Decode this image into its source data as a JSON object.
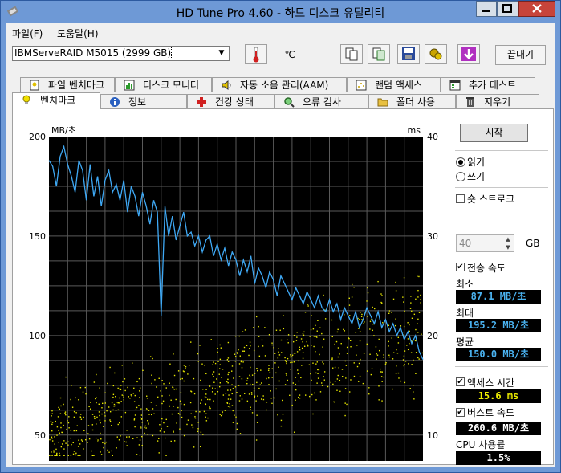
{
  "window": {
    "title": "HD Tune Pro 4.60 - 하드 디스크 유틸리티"
  },
  "menu": {
    "file": "파일(F)",
    "help": "도움말(H)"
  },
  "toolbar": {
    "drive": "IBMServeRAID M5015 (2999 GB)",
    "temperature": "-- ℃",
    "exit": "끝내기",
    "icons": [
      "copy-icon",
      "copy-info-icon",
      "save-icon",
      "options-icon",
      "download-icon"
    ]
  },
  "tabs_top": [
    {
      "label": "파일 벤치마크",
      "icon": "file-benchmark-icon"
    },
    {
      "label": "디스크 모니터",
      "icon": "disk-monitor-icon"
    },
    {
      "label": "자동 소음 관리(AAM)",
      "icon": "speaker-icon"
    },
    {
      "label": "랜덤 액세스",
      "icon": "random-access-icon"
    },
    {
      "label": "추가 테스트",
      "icon": "extra-tests-icon"
    }
  ],
  "tabs_bottom": [
    {
      "label": "벤치마크",
      "icon": "lightbulb-icon",
      "active": true
    },
    {
      "label": "정보",
      "icon": "info-icon"
    },
    {
      "label": "건강 상태",
      "icon": "health-cross-icon"
    },
    {
      "label": "오류 검사",
      "icon": "magnifier-icon"
    },
    {
      "label": "폴더 사용",
      "icon": "folder-icon"
    },
    {
      "label": "지우기",
      "icon": "trash-icon"
    }
  ],
  "controls": {
    "start": "시작",
    "read": "읽기",
    "write": "쓰기",
    "short_stroke": "숏 스트로크",
    "short_stroke_value": "40",
    "gb": "GB",
    "transfer_rate": "전송 속도",
    "min_label": "최소",
    "min_value": "87.1 MB/초",
    "max_label": "최대",
    "max_value": "195.2 MB/초",
    "avg_label": "평균",
    "avg_value": "150.0 MB/초",
    "access_time": "엑세스 시간",
    "access_value": "15.6 ms",
    "burst_rate": "버스트 속도",
    "burst_value": "260.6 MB/초",
    "cpu_label": "CPU 사용률",
    "cpu_value": "1.5%"
  },
  "colors": {
    "transfer_line": "#3fa9f5",
    "access_dots": "#e8e800",
    "plot_bg": "#000000"
  },
  "chart_data": {
    "type": "line",
    "ylabel_left": "MB/초",
    "ylabel_right": "ms",
    "yticks_left": [
      50,
      100,
      150,
      200
    ],
    "yticks_right": [
      10,
      20,
      30,
      40
    ],
    "ylim_left": [
      37,
      200
    ],
    "ylim_right": [
      7.4,
      40
    ],
    "x": [
      0,
      1,
      2,
      3,
      4,
      5,
      6,
      7,
      8,
      9,
      10,
      11,
      12,
      13,
      14,
      15,
      16,
      17,
      18,
      19,
      20,
      21,
      22,
      23,
      24,
      25,
      26,
      27,
      28,
      29,
      30,
      31,
      32,
      33,
      34,
      35,
      36,
      37,
      38,
      39,
      40,
      41,
      42,
      43,
      44,
      45,
      46,
      47,
      48,
      49,
      50,
      51,
      52,
      53,
      54,
      55,
      56,
      57,
      58,
      59,
      60,
      61,
      62,
      63,
      64,
      65,
      66,
      67,
      68,
      69,
      70,
      71,
      72,
      73,
      74,
      75,
      76,
      77,
      78,
      79,
      80,
      81,
      82,
      83,
      84,
      85,
      86,
      87,
      88,
      89,
      90,
      91,
      92,
      93,
      94,
      95,
      96,
      97,
      98,
      99,
      100
    ],
    "series": [
      {
        "values": [
          188,
          185,
          175,
          190,
          195,
          186,
          180,
          172,
          188,
          183,
          168,
          186,
          170,
          180,
          165,
          178,
          183,
          172,
          176,
          168,
          178,
          162,
          175,
          170,
          160,
          172,
          165,
          156,
          168,
          162,
          110,
          165,
          150,
          160,
          148,
          155,
          162,
          150,
          152,
          145,
          150,
          142,
          148,
          150,
          140,
          146,
          138,
          144,
          135,
          142,
          138,
          130,
          138,
          132,
          140,
          126,
          134,
          130,
          124,
          132,
          128,
          120,
          130,
          126,
          122,
          118,
          124,
          120,
          116,
          122,
          118,
          114,
          120,
          114,
          112,
          118,
          112,
          116,
          108,
          114,
          110,
          106,
          112,
          104,
          108,
          114,
          110,
          106,
          112,
          104,
          108,
          102,
          106,
          100,
          104,
          98,
          102,
          96,
          100,
          92,
          88
        ]
      }
    ],
    "access_time_ms": {
      "min": 8,
      "max": 26,
      "mean": 15.6
    },
    "grid": true
  }
}
